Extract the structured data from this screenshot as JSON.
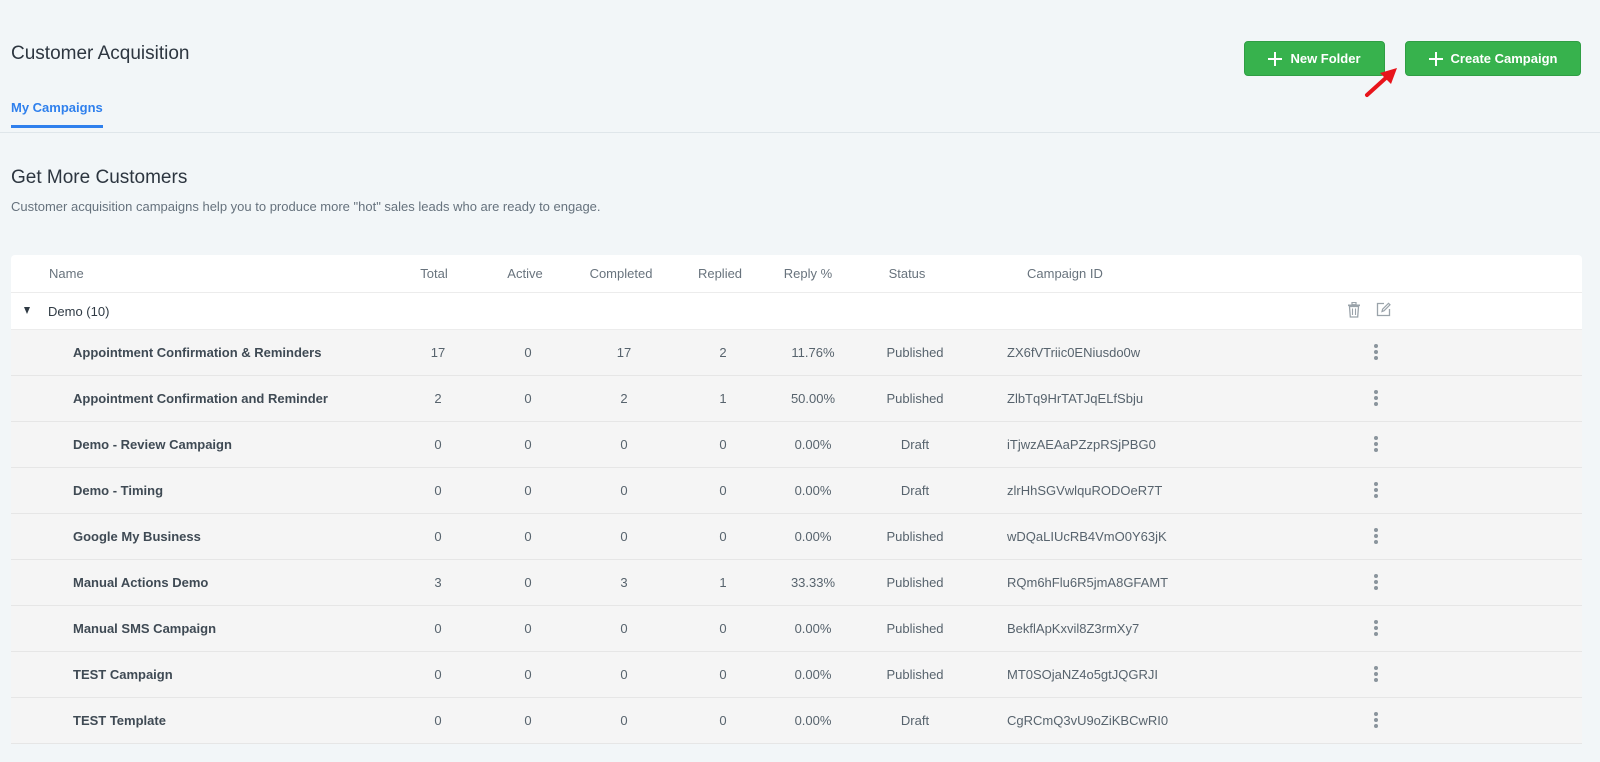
{
  "page": {
    "title": "Customer Acquisition"
  },
  "header": {
    "new_folder_label": "New Folder",
    "create_campaign_label": "Create Campaign"
  },
  "tabs": [
    {
      "label": "My Campaigns",
      "active": true
    }
  ],
  "section": {
    "title": "Get More Customers",
    "description": "Customer acquisition campaigns help you to produce more \"hot\" sales leads who are ready to engage."
  },
  "table": {
    "columns": [
      "Name",
      "Total",
      "Active",
      "Completed",
      "Replied",
      "Reply %",
      "Status",
      "Campaign ID"
    ],
    "group": {
      "name": "Demo (10)",
      "expanded": true
    },
    "rows": [
      {
        "name": "Appointment Confirmation & Reminders",
        "total": "17",
        "active": "0",
        "completed": "17",
        "replied": "2",
        "reply_pct": "11.76%",
        "status": "Published",
        "campaign_id": "ZX6fVTriic0ENiusdo0w"
      },
      {
        "name": "Appointment Confirmation and Reminder",
        "total": "2",
        "active": "0",
        "completed": "2",
        "replied": "1",
        "reply_pct": "50.00%",
        "status": "Published",
        "campaign_id": "ZlbTq9HrTATJqELfSbju"
      },
      {
        "name": "Demo - Review Campaign",
        "total": "0",
        "active": "0",
        "completed": "0",
        "replied": "0",
        "reply_pct": "0.00%",
        "status": "Draft",
        "campaign_id": "iTjwzAEAaPZzpRSjPBG0"
      },
      {
        "name": "Demo - Timing",
        "total": "0",
        "active": "0",
        "completed": "0",
        "replied": "0",
        "reply_pct": "0.00%",
        "status": "Draft",
        "campaign_id": "zlrHhSGVwlquRODOeR7T"
      },
      {
        "name": "Google My Business",
        "total": "0",
        "active": "0",
        "completed": "0",
        "replied": "0",
        "reply_pct": "0.00%",
        "status": "Published",
        "campaign_id": "wDQaLIUcRB4VmO0Y63jK"
      },
      {
        "name": "Manual Actions Demo",
        "total": "3",
        "active": "0",
        "completed": "3",
        "replied": "1",
        "reply_pct": "33.33%",
        "status": "Published",
        "campaign_id": "RQm6hFlu6R5jmA8GFAMT"
      },
      {
        "name": "Manual SMS Campaign",
        "total": "0",
        "active": "0",
        "completed": "0",
        "replied": "0",
        "reply_pct": "0.00%",
        "status": "Published",
        "campaign_id": "BekflApKxvil8Z3rmXy7"
      },
      {
        "name": "TEST Campaign",
        "total": "0",
        "active": "0",
        "completed": "0",
        "replied": "0",
        "reply_pct": "0.00%",
        "status": "Published",
        "campaign_id": "MT0SOjaNZ4o5gtJQGRJI"
      },
      {
        "name": "TEST Template",
        "total": "0",
        "active": "0",
        "completed": "0",
        "replied": "0",
        "reply_pct": "0.00%",
        "status": "Draft",
        "campaign_id": "CgRCmQ3vU9oZiKBCwRI0"
      }
    ]
  },
  "colors": {
    "accent_green": "#37b24d",
    "tab_blue": "#2f80ed",
    "pointer_red": "#e8141b"
  },
  "icons": {
    "trash": "trash-icon",
    "edit": "edit-icon",
    "kebab": "more-vertical-icon",
    "plus": "plus-icon",
    "pointer": "red-arrow-pointer-icon"
  }
}
